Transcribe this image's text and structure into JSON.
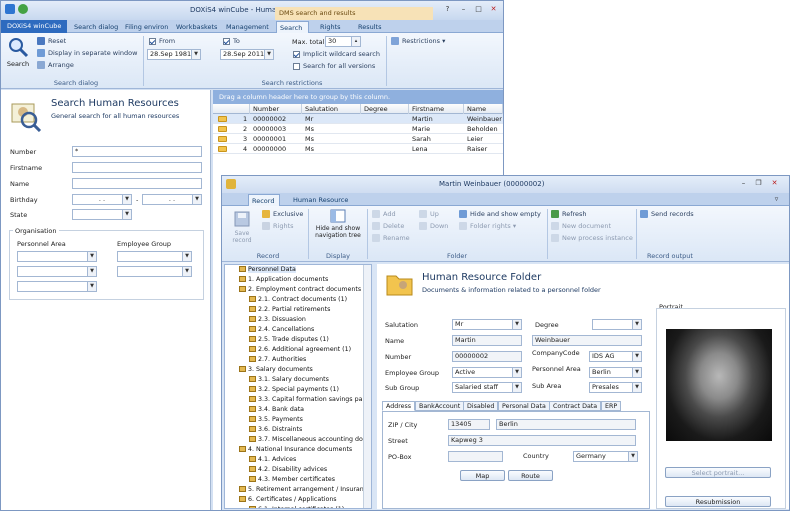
{
  "main_window": {
    "title": "DOXiS4 winCube - Human Resources",
    "context_header": "DMS search and results",
    "app_tab": "DOXiS4 winCube",
    "tabs": [
      "Search dialog",
      "Filing environ",
      "Workbaskets",
      "Management",
      "Search",
      "Rights",
      "Results"
    ],
    "ribbon": {
      "search_label": "Search",
      "reset": "Reset",
      "display_separate": "Display in separate window",
      "arrange": "Arrange",
      "group_search_dialog": "Search dialog",
      "from_label": "From",
      "to_label": "To",
      "from_date": "28.Sep 1981",
      "to_date": "28.Sep 2011",
      "max_total_label": "Max. total",
      "max_total_value": "30",
      "implicit_wildcard": "Implicit wildcard search",
      "search_all_versions": "Search for all versions",
      "restrictions": "Restrictions",
      "group_search_restrictions": "Search restrictions"
    }
  },
  "search_panel": {
    "title": "Search Human Resources",
    "subtitle": "General search for all human resources",
    "fields": {
      "number_label": "Number",
      "number_value": "*",
      "firstname_label": "Firstname",
      "name_label": "Name",
      "birthday_label": "Birthday",
      "birthday_from": ". .",
      "birthday_sep": "-",
      "birthday_to": ". .",
      "state_label": "State"
    },
    "organisation_label": "Organisation",
    "personnel_area_label": "Personnel Area",
    "employee_group_label": "Employee Group"
  },
  "results_grid": {
    "group_hint": "Drag a column header here to group by this column.",
    "columns": [
      "Number",
      "Salutation",
      "Degree",
      "Firstname",
      "Name"
    ],
    "rows": [
      {
        "index": "1",
        "number": "00000002",
        "salutation": "Mr",
        "degree": "",
        "firstname": "Martin",
        "name": "Weinbauer"
      },
      {
        "index": "2",
        "number": "00000003",
        "salutation": "Ms",
        "degree": "",
        "firstname": "Marie",
        "name": "Beholden"
      },
      {
        "index": "3",
        "number": "00000001",
        "salutation": "Ms",
        "degree": "",
        "firstname": "Sarah",
        "name": "Leier"
      },
      {
        "index": "4",
        "number": "00000000",
        "salutation": "Ms",
        "degree": "",
        "firstname": "Lena",
        "name": "Raiser"
      }
    ]
  },
  "record_window": {
    "title": "Martin Weinbauer (00000002)",
    "tabs": [
      "Record",
      "Human Resource"
    ],
    "ribbon": {
      "save_record": "Save record",
      "exclusive": "Exclusive",
      "rights": "Rights",
      "group_record": "Record",
      "hide_show_tree": "Hide and show navigation tree",
      "group_display": "Display",
      "add": "Add",
      "delete": "Delete",
      "rename": "Rename",
      "up": "Up",
      "down": "Down",
      "hide_show_empty": "Hide and show empty",
      "folder_rights": "Folder rights",
      "group_folder": "Folder",
      "refresh": "Refresh",
      "new_document": "New document",
      "new_process_instance": "New process instance",
      "send_records": "Send records",
      "group_record_output": "Record output"
    },
    "tree": [
      "Personnel Data",
      "1. Application documents",
      "2. Employment contract documents",
      "2.1. Contract documents (1)",
      "2.2. Partial retirements",
      "2.3. Dissuasion",
      "2.4. Cancellations",
      "2.5. Trade disputes (1)",
      "2.6. Additional agreement (1)",
      "2.7. Authorities",
      "3. Salary documents",
      "3.1. Salary documents",
      "3.2. Special payments (1)",
      "3.3. Capital formation savings pa",
      "3.4. Bank data",
      "3.5. Payments",
      "3.6. Distraints",
      "3.7. Miscellaneous accounting do",
      "4. National Insurance documents",
      "4.1. Advices",
      "4.2. Disability advices",
      "4.3. Member certificates",
      "5. Retirement arrangement / Insuran",
      "6. Certificates / Applications",
      "6.1. Internal certificates (1)"
    ],
    "folder_title": "Human Resource Folder",
    "folder_subtitle": "Documents & information related to a personnel folder",
    "form": {
      "salutation_label": "Salutation",
      "salutation_value": "Mr",
      "degree_label": "Degree",
      "degree_value": "",
      "name_label": "Name",
      "first_name": "Martin",
      "last_name": "Weinbauer",
      "number_label": "Number",
      "number_value": "00000002",
      "company_code_label": "CompanyCode",
      "company_code_value": "IDS AG",
      "employee_group_label": "Employee Group",
      "employee_group_value": "Active",
      "personnel_area_label": "Personnel Area",
      "personnel_area_value": "Berlin",
      "sub_group_label": "Sub Group",
      "sub_group_value": "Salaried staff",
      "sub_area_label": "Sub Area",
      "sub_area_value": "Presales"
    },
    "detail_tabs": [
      "Address",
      "BankAccount",
      "Disabled",
      "Personal Data",
      "Contract Data",
      "ERP"
    ],
    "address": {
      "zip_city_label": "ZIP / City",
      "zip": "13405",
      "city": "Berlin",
      "street_label": "Street",
      "street": "Kapweg 3",
      "pobox_label": "PO-Box",
      "country_label": "Country",
      "country": "Germany",
      "map_button": "Map",
      "route_button": "Route"
    },
    "portrait_label": "Portrait",
    "select_portrait": "Select portrait...",
    "resubmission": "Resubmission"
  }
}
